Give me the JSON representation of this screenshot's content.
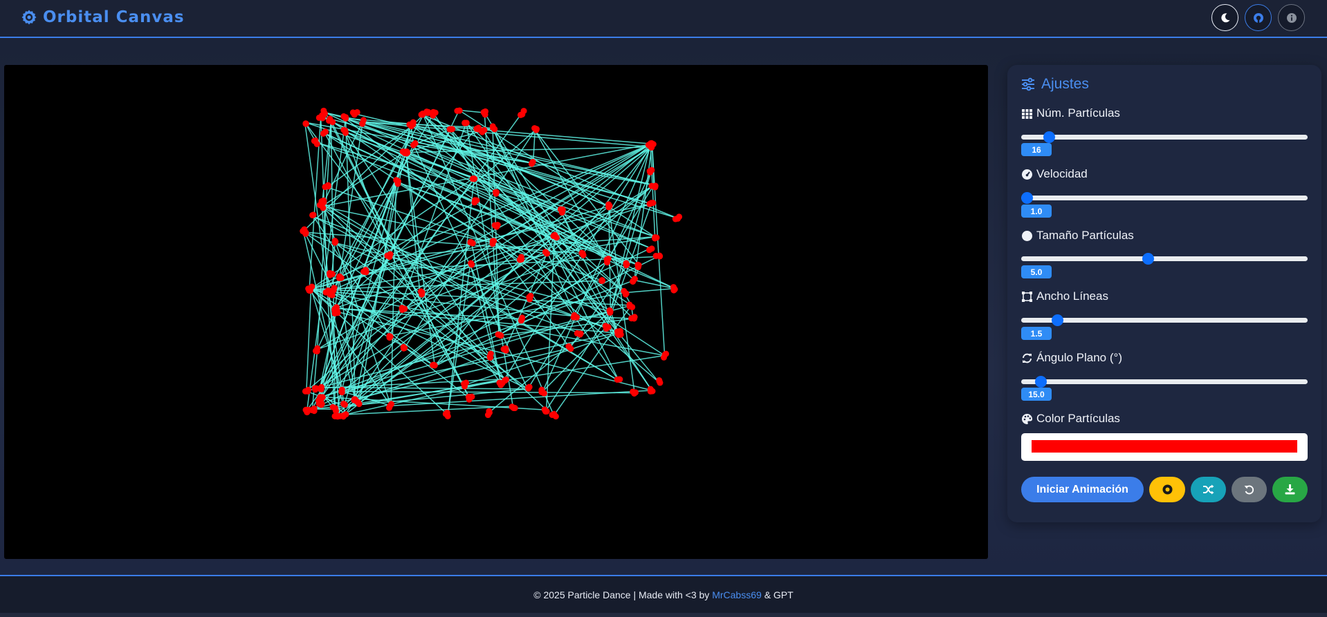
{
  "app": {
    "title": "Orbital Canvas",
    "accent_color": "#4a8ef0",
    "icons": [
      "atom-gear-icon",
      "moon-icon",
      "github-icon",
      "info-icon"
    ]
  },
  "canvas": {
    "background": "#000000",
    "particle_color": "#ff0000",
    "line_color": "#5ff5e6"
  },
  "panel": {
    "title": "Ajustes",
    "controls": [
      {
        "label": "Núm. Partículas",
        "value": "16",
        "fraction": 0.08,
        "icon": "grid-icon"
      },
      {
        "label": "Velocidad",
        "value": "1.0",
        "fraction": 0.0,
        "icon": "gauge-icon"
      },
      {
        "label": "Tamaño Partículas",
        "value": "5.0",
        "fraction": 0.44,
        "icon": "circle-icon"
      },
      {
        "label": "Ancho Líneas",
        "value": "1.5",
        "fraction": 0.11,
        "icon": "vector-square-icon"
      },
      {
        "label": "Ángulo Plano (°)",
        "value": "15.0",
        "fraction": 0.05,
        "icon": "sync-icon"
      }
    ],
    "color_label": "Color Partículas",
    "color_value": "#ff0000",
    "buttons": {
      "start": "Iniciar Animación",
      "record_icon": "record-icon",
      "shuffle_icon": "shuffle-icon",
      "reset_icon": "undo-icon",
      "download_icon": "download-icon"
    }
  },
  "footer": {
    "prefix": "© 2025 Particle Dance | Made with <3 by",
    "author": "MrCabss69",
    "suffix": "& GPT"
  }
}
